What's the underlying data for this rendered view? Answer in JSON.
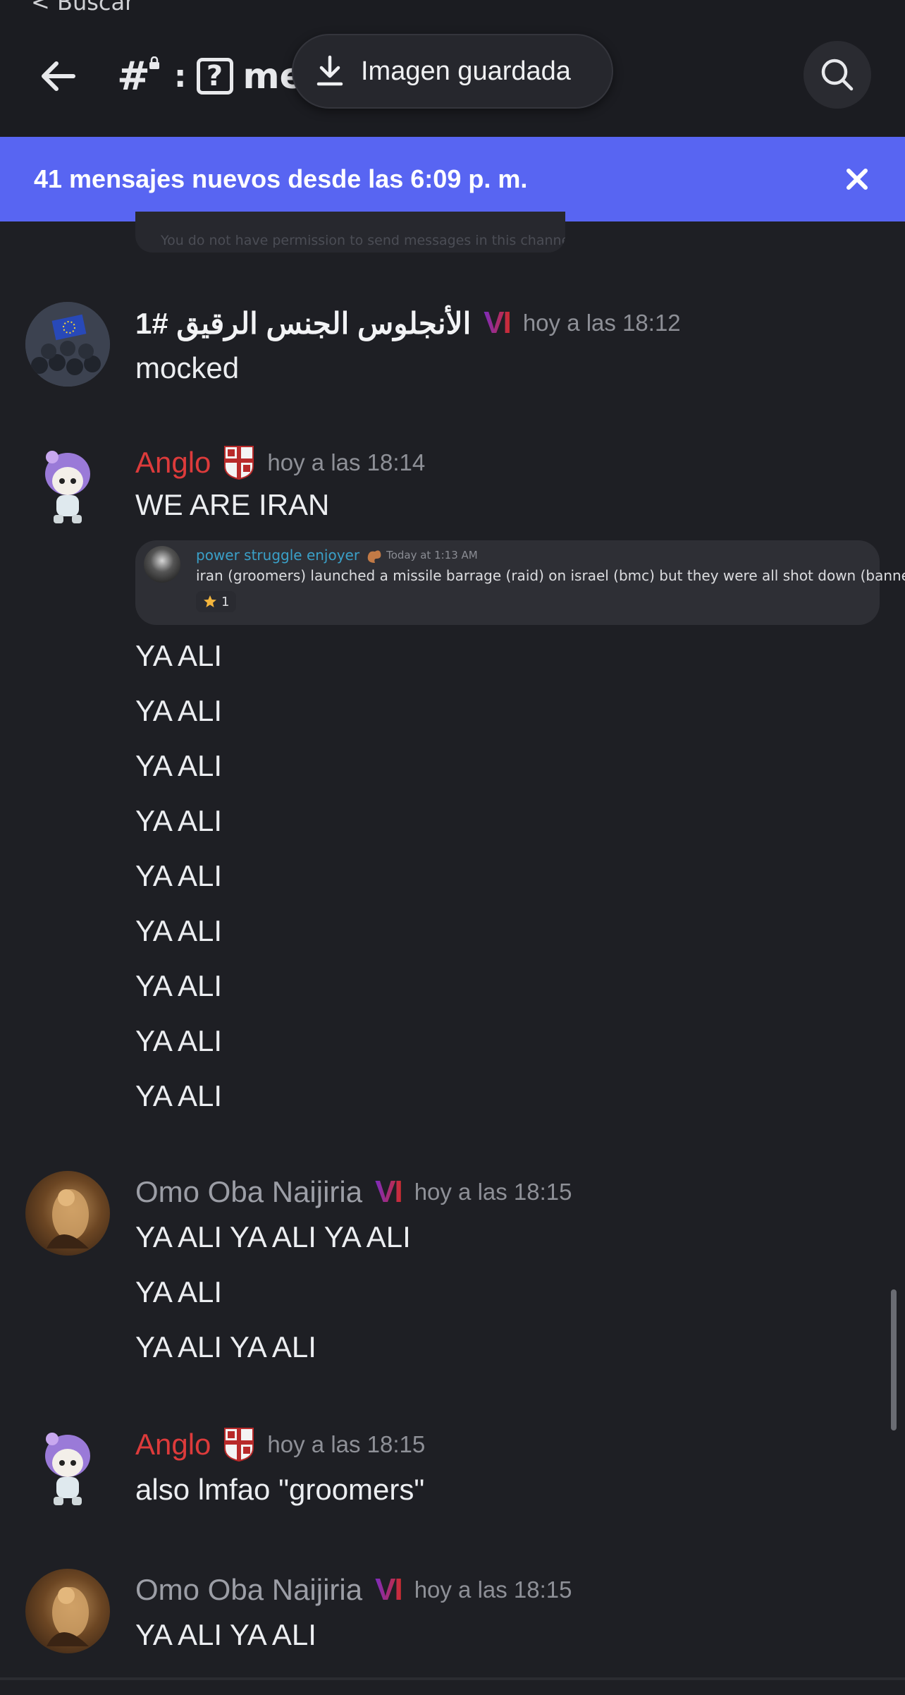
{
  "header": {
    "back_crumb": "< Buscar",
    "channel_hash": "#",
    "channel_colon": ":",
    "channel_icon": "?",
    "channel_name": "met",
    "toast_text": "Imagen guardada",
    "icons": [
      "back-arrow-icon",
      "hashtag-lock-icon",
      "download-icon",
      "search-icon"
    ]
  },
  "banner": {
    "text": "41 mensajes nuevos desde las 6:09 p. m.",
    "close_icon": "close-icon",
    "color": "#5865f2"
  },
  "faded_embed_text": "You do not have permission to send messages in this channel",
  "messages": [
    {
      "author": "1# الأنجلوس الجنس الرقيق",
      "badge": "VI",
      "time": "hoy a las 18:12",
      "lines": [
        "mocked"
      ]
    },
    {
      "author": "Anglo",
      "time": "hoy a las 18:14",
      "lines": [
        "WE ARE IRAN"
      ],
      "quote": {
        "author": "power struggle enjoyer",
        "time": "Today at 1:13 AM",
        "text": "iran (groomers) launched a missile barrage (raid) on israel (bmc) but they were all shot down (banned)",
        "reaction_count": "1"
      },
      "after_lines": [
        "YA ALI",
        "YA ALI",
        "YA ALI",
        "YA ALI",
        "YA ALI",
        "YA ALI",
        "YA ALI",
        "YA ALI",
        "YA ALI"
      ]
    },
    {
      "author": "Omo Oba Naijiria",
      "badge": "VI",
      "time": "hoy a las 18:15",
      "lines": [
        "YA ALI YA ALI YA ALI",
        "YA ALI",
        "YA ALI YA ALI"
      ]
    },
    {
      "author": "Anglo",
      "time": "hoy a las 18:15",
      "lines": [
        "also lmfao \"groomers\""
      ]
    },
    {
      "author": "Omo Oba Naijiria",
      "badge": "VI",
      "time": "hoy a las 18:15",
      "lines": [
        "YA ALI YA ALI"
      ]
    }
  ],
  "colors": {
    "background": "#1e1f24",
    "name_red": "#dd3b3b",
    "name_gray": "#9c9ea6",
    "quote_name": "#3aa0c8"
  }
}
